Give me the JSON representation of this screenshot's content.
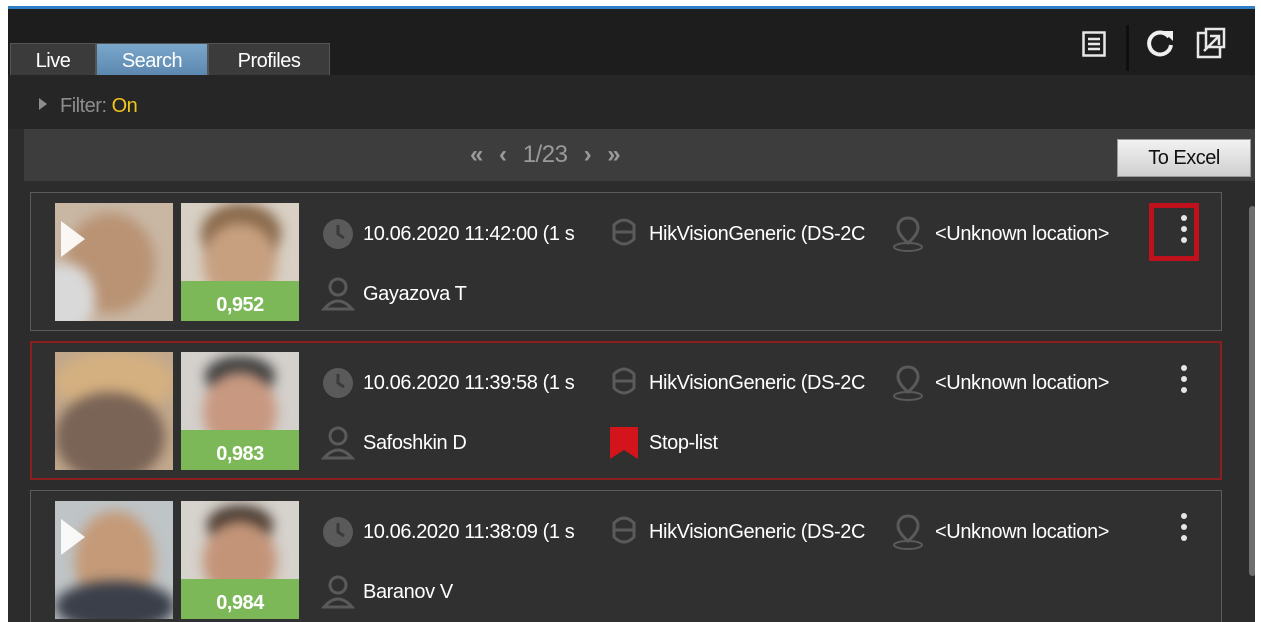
{
  "tabs": [
    {
      "label": "Live",
      "active": false
    },
    {
      "label": "Search",
      "active": true
    },
    {
      "label": "Profiles",
      "active": false
    }
  ],
  "toolbar": {
    "icons": [
      "list-icon",
      "refresh-icon",
      "popout-icon"
    ]
  },
  "filter": {
    "label": "Filter:",
    "value": "On",
    "value_color": "#f0c419"
  },
  "pager": {
    "first": "«",
    "prev": "‹",
    "page": "1/23",
    "next": "›",
    "last": "»"
  },
  "export_button": "To Excel",
  "results": [
    {
      "score": "0,952",
      "timestamp": "10.06.2020 11:42:00 (1 s",
      "camera": "HikVisionGeneric (DS-2C",
      "location": "<Unknown location>",
      "name": "Gayazova T",
      "list": "",
      "has_play": true,
      "menu_highlighted": true
    },
    {
      "score": "0,983",
      "timestamp": "10.06.2020 11:39:58 (1 s",
      "camera": "HikVisionGeneric (DS-2C",
      "location": "<Unknown location>",
      "name": "Safoshkin D",
      "list": "Stop-list",
      "has_play": false,
      "menu_highlighted": false
    },
    {
      "score": "0,984",
      "timestamp": "10.06.2020 11:38:09 (1 s",
      "camera": "HikVisionGeneric (DS-2C",
      "location": "<Unknown location>",
      "name": "Baranov V",
      "list": "",
      "has_play": true,
      "menu_highlighted": false
    }
  ],
  "colors": {
    "accent": "#2f7fc8",
    "alert_border": "#8b1e1e",
    "stoplist_flag": "#d3141b",
    "score_band": "#7db858"
  }
}
